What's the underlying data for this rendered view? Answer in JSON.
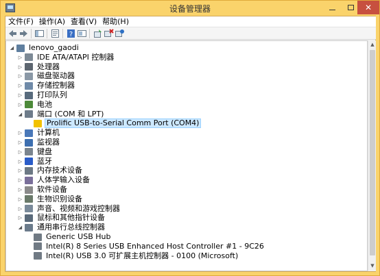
{
  "window": {
    "title": "设备管理器",
    "min_glyph": "—",
    "max_glyph": "□",
    "close_glyph": "✕"
  },
  "menu": {
    "file": "文件(F)",
    "action": "操作(A)",
    "view": "查看(V)",
    "help": "帮助(H)"
  },
  "toolbar": {
    "icons": [
      "back-icon",
      "forward-icon",
      "console-tree-icon",
      "properties-icon",
      "help-icon",
      "show-hidden-icon",
      "update-driver-icon",
      "uninstall-icon",
      "scan-hardware-icon"
    ]
  },
  "tree": {
    "root": "lenovo_gaodi",
    "categories": [
      {
        "label": "IDE ATA/ATAPI 控制器",
        "expanded": false
      },
      {
        "label": "处理器",
        "expanded": false
      },
      {
        "label": "磁盘驱动器",
        "expanded": false
      },
      {
        "label": "存储控制器",
        "expanded": false
      },
      {
        "label": "打印队列",
        "expanded": false
      },
      {
        "label": "电池",
        "expanded": false
      },
      {
        "label": "端口 (COM 和 LPT)",
        "expanded": true
      },
      {
        "label": "计算机",
        "expanded": false
      },
      {
        "label": "监视器",
        "expanded": false
      },
      {
        "label": "键盘",
        "expanded": false
      },
      {
        "label": "蓝牙",
        "expanded": false
      },
      {
        "label": "内存技术设备",
        "expanded": false
      },
      {
        "label": "人体学输入设备",
        "expanded": false
      },
      {
        "label": "软件设备",
        "expanded": false
      },
      {
        "label": "生物识别设备",
        "expanded": false
      },
      {
        "label": "声音、视频和游戏控制器",
        "expanded": false
      },
      {
        "label": "鼠标和其他指针设备",
        "expanded": false
      },
      {
        "label": "通用串行总线控制器",
        "expanded": true
      }
    ],
    "port_child": "Prolific USB-to-Serial Comm Port (COM4)",
    "usb_children": [
      "Generic USB Hub",
      "Intel(R) 8 Series USB Enhanced Host Controller #1 - 9C26",
      "Intel(R) USB 3.0 可扩展主机控制器 - 0100 (Microsoft)"
    ],
    "collapsed_glyph": "▷",
    "expanded_glyph": "◢"
  },
  "colors": {
    "frame": "#fad36b",
    "close": "#c7503f",
    "selection": "#cce8ff",
    "warning": "#f2c200"
  }
}
